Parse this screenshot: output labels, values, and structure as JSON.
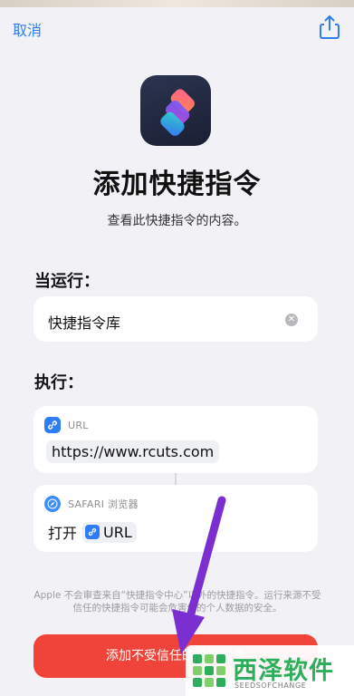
{
  "nav": {
    "cancel_label": "取消",
    "share_icon": "share-icon"
  },
  "header": {
    "title": "添加快捷指令",
    "subtitle": "查看此快捷指令的内容。"
  },
  "trigger": {
    "label": "当运行：",
    "value": "快捷指令库",
    "clear_icon": "clear-icon"
  },
  "actions": {
    "label": "执行：",
    "items": [
      {
        "type_label": "URL",
        "value": "https://www.rcuts.com",
        "icon": "link-icon"
      },
      {
        "type_label": "SAFARI 浏览器",
        "verb": "打开",
        "token": "URL",
        "icon": "compass-icon"
      }
    ]
  },
  "footnote": "Apple 不会审查来自“快捷指令中心”以外的快捷指令。运行来源不受信任的快捷指令可能会危害你的个人数据的安全。",
  "add_button": {
    "label": "添加不受信任的快捷指令"
  },
  "watermark": {
    "name": "西泽软件",
    "sub": "SEEDSOFCHANGE"
  },
  "colors": {
    "accent": "#2f7df6",
    "danger": "#f0433a",
    "background": "#f2f2f6",
    "arrow": "#7b2fd0",
    "watermark_green": "#2cae5a"
  }
}
